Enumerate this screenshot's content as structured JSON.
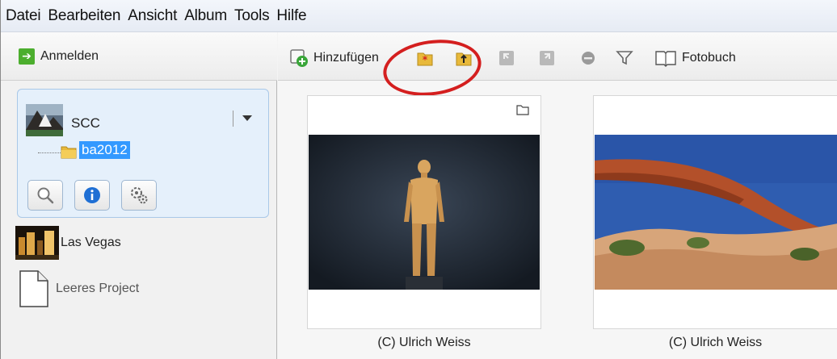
{
  "menubar": {
    "items": [
      "Datei",
      "Bearbeiten",
      "Ansicht",
      "Album",
      "Tools",
      "Hilfe"
    ]
  },
  "left_pane": {
    "login_label": "Anmelden",
    "active_album": {
      "name": "SCC",
      "folder": "ba2012"
    },
    "tool_buttons": [
      "search-icon",
      "info-icon",
      "settings-icon"
    ],
    "projects": [
      {
        "name": "Las Vegas"
      },
      {
        "name": "Leeres Project"
      }
    ]
  },
  "toolbar": {
    "add_label": "Hinzufügen",
    "photobook_label": "Fotobuch"
  },
  "photos": [
    {
      "caption": "(C) Ulrich Weiss"
    },
    {
      "caption": "(C) Ulrich Weiss"
    }
  ],
  "colors": {
    "accent_box": "#e5f0fb",
    "selection": "#3399ff",
    "highlight_ring": "#d41f1f",
    "login_green": "#4cae2e"
  }
}
